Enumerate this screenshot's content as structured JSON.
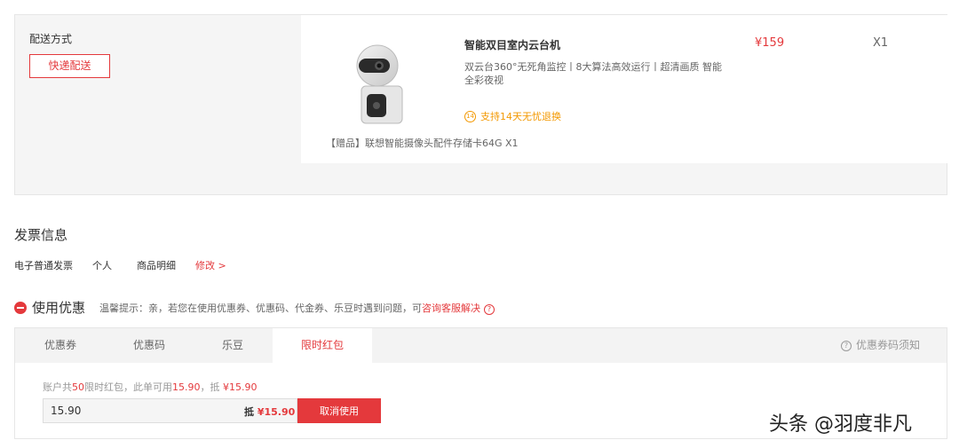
{
  "delivery": {
    "label": "配送方式",
    "option": "快递配送"
  },
  "product": {
    "image_icon": "camera-product-image",
    "title": "智能双目室内云台机",
    "description": "双云台360°无死角监控丨8大算法高效运行丨超清画质 智能全彩夜视",
    "return_badge": "14",
    "return_policy": "支持14天无忧退换",
    "price": "¥159",
    "quantity": "X1",
    "gift": "【赠品】联想智能摄像头配件存储卡64G X1"
  },
  "invoice": {
    "title": "发票信息",
    "type": "电子普通发票",
    "holder": "个人",
    "content": "商品明细",
    "edit": "修改 >"
  },
  "coupon": {
    "title": "使用优惠",
    "tip_prefix": "温馨提示：亲，若您在使用优惠券、优惠码、代金券、乐豆时遇到问题，可",
    "tip_link": "咨询客服解决",
    "help_glyph": "?",
    "tabs": [
      {
        "label": "优惠券"
      },
      {
        "label": "优惠码"
      },
      {
        "label": "乐豆"
      },
      {
        "label": "限时红包"
      }
    ],
    "active_tab": "限时红包",
    "notice_glyph": "?",
    "notice_label": "优惠券码须知",
    "balance": {
      "t1": "账户共",
      "total": "50",
      "t2": "限时红包，此单可用",
      "usable": "15.90",
      "t3": "，抵 ",
      "deduct": "¥15.90"
    },
    "input_value": "15.90",
    "deduct_label": "抵",
    "deduct_value": "¥15.90",
    "cancel_label": "取消使用"
  },
  "watermark": "头条 @羽度非凡",
  "colors": {
    "accent": "#e4393c",
    "warning": "#f39800"
  }
}
